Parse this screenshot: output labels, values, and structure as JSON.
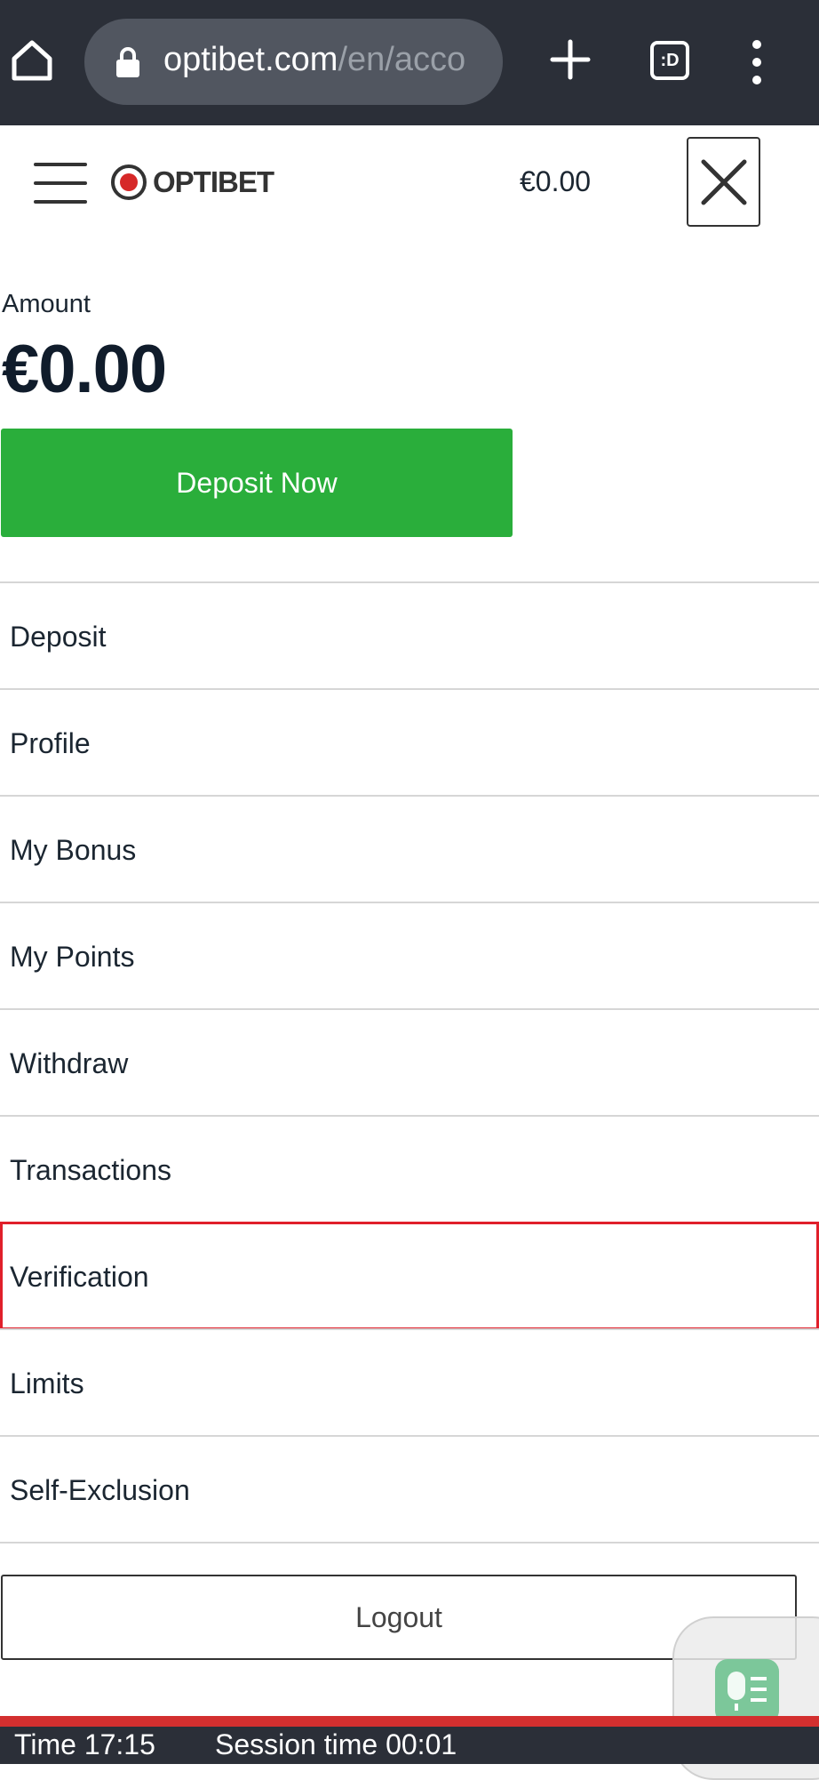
{
  "browser": {
    "url_host": "optibet.com",
    "url_path": "/en/acco",
    "tab_switcher_label": ":D",
    "icons": [
      "home-icon",
      "lock-icon",
      "plus-icon",
      "tabs-icon",
      "more-vert-icon"
    ]
  },
  "header": {
    "logo_text": "OPTIBET",
    "balance": "€0.00",
    "icons": [
      "hamburger-icon",
      "close-icon"
    ]
  },
  "account": {
    "amount_label": "Amount",
    "amount_value": "€0.00",
    "deposit_now_label": "Deposit Now"
  },
  "menu": {
    "items": [
      {
        "label": "Deposit"
      },
      {
        "label": "Profile"
      },
      {
        "label": "My Bonus"
      },
      {
        "label": "My Points"
      },
      {
        "label": "Withdraw"
      },
      {
        "label": "Transactions"
      },
      {
        "label": "Verification",
        "highlighted": true
      },
      {
        "label": "Limits"
      },
      {
        "label": "Self-Exclusion"
      }
    ],
    "logout_label": "Logout"
  },
  "footer": {
    "time": "Time 17:15",
    "session": "Session time 00:01"
  },
  "colors": {
    "deposit_green": "#2aae3b",
    "highlight_red": "#e01f2a",
    "chrome_dark": "#2b2f38"
  }
}
